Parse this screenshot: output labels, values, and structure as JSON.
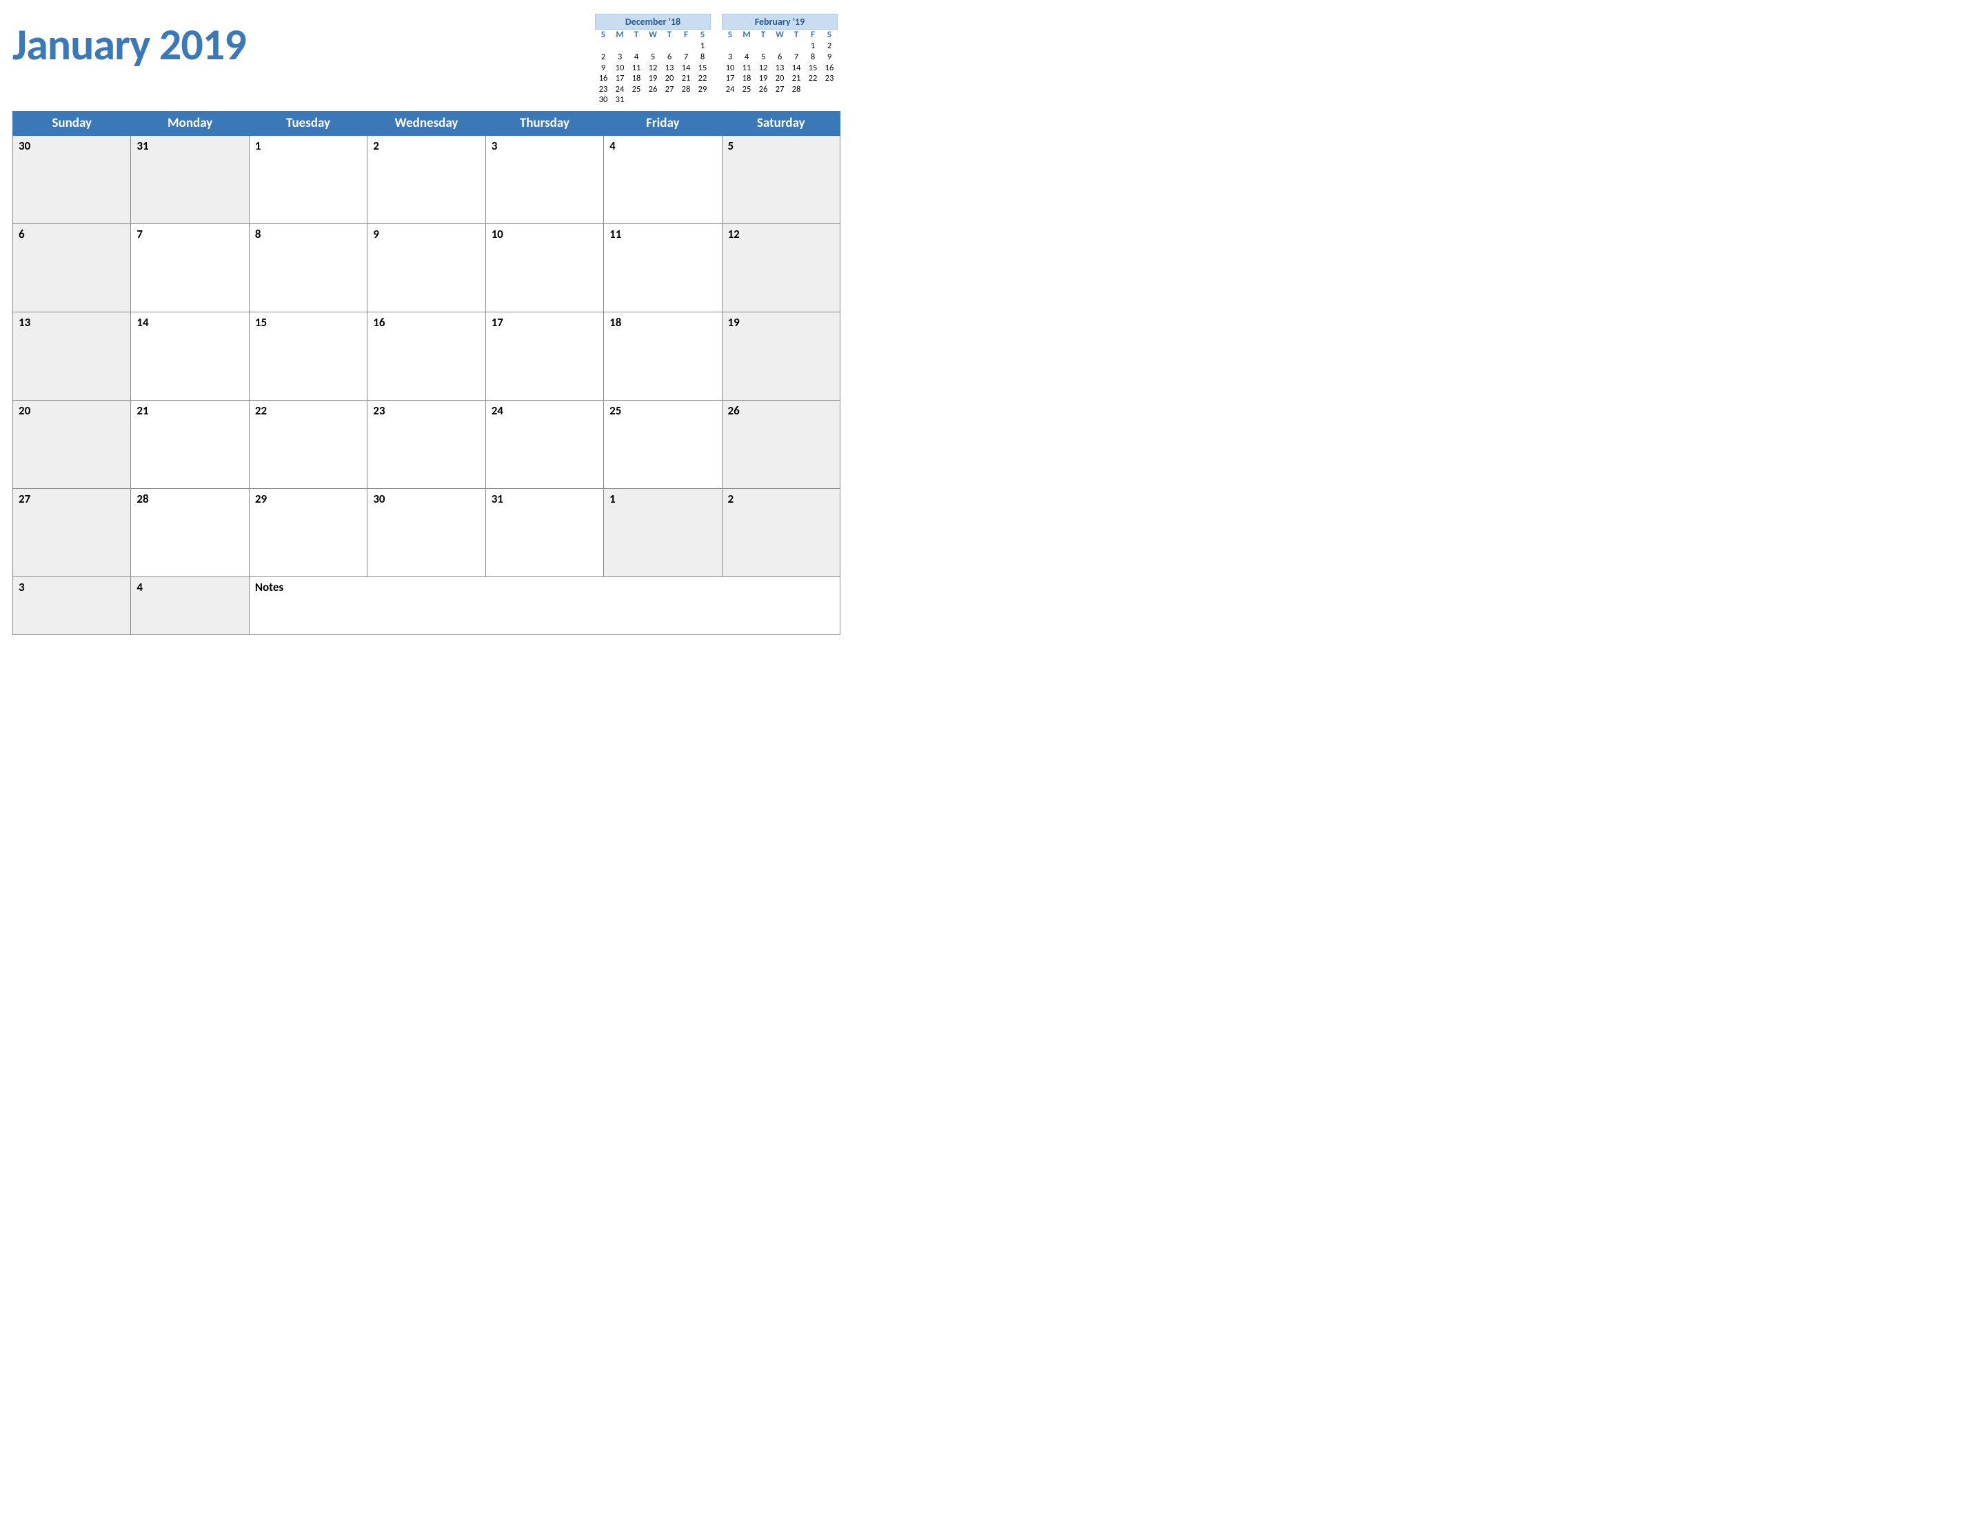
{
  "title": "January 2019",
  "dow_full": [
    "Sunday",
    "Monday",
    "Tuesday",
    "Wednesday",
    "Thursday",
    "Friday",
    "Saturday"
  ],
  "mini": [
    {
      "title": "December '18",
      "dow": [
        "S",
        "M",
        "T",
        "W",
        "T",
        "F",
        "S"
      ],
      "rows": [
        [
          "",
          "",
          "",
          "",
          "",
          "",
          "1"
        ],
        [
          "2",
          "3",
          "4",
          "5",
          "6",
          "7",
          "8"
        ],
        [
          "9",
          "10",
          "11",
          "12",
          "13",
          "14",
          "15"
        ],
        [
          "16",
          "17",
          "18",
          "19",
          "20",
          "21",
          "22"
        ],
        [
          "23",
          "24",
          "25",
          "26",
          "27",
          "28",
          "29"
        ],
        [
          "30",
          "31",
          "",
          "",
          "",
          "",
          ""
        ]
      ]
    },
    {
      "title": "February '19",
      "dow": [
        "S",
        "M",
        "T",
        "W",
        "T",
        "F",
        "S"
      ],
      "rows": [
        [
          "",
          "",
          "",
          "",
          "",
          "1",
          "2"
        ],
        [
          "3",
          "4",
          "5",
          "6",
          "7",
          "8",
          "9"
        ],
        [
          "10",
          "11",
          "12",
          "13",
          "14",
          "15",
          "16"
        ],
        [
          "17",
          "18",
          "19",
          "20",
          "21",
          "22",
          "23"
        ],
        [
          "24",
          "25",
          "26",
          "27",
          "28",
          "",
          ""
        ]
      ]
    }
  ],
  "grid": [
    [
      {
        "n": "30",
        "cls": "outside"
      },
      {
        "n": "31",
        "cls": "outside"
      },
      {
        "n": "1",
        "cls": ""
      },
      {
        "n": "2",
        "cls": ""
      },
      {
        "n": "3",
        "cls": ""
      },
      {
        "n": "4",
        "cls": ""
      },
      {
        "n": "5",
        "cls": "weekend"
      }
    ],
    [
      {
        "n": "6",
        "cls": "weekend"
      },
      {
        "n": "7",
        "cls": ""
      },
      {
        "n": "8",
        "cls": ""
      },
      {
        "n": "9",
        "cls": ""
      },
      {
        "n": "10",
        "cls": ""
      },
      {
        "n": "11",
        "cls": ""
      },
      {
        "n": "12",
        "cls": "weekend"
      }
    ],
    [
      {
        "n": "13",
        "cls": "weekend"
      },
      {
        "n": "14",
        "cls": ""
      },
      {
        "n": "15",
        "cls": ""
      },
      {
        "n": "16",
        "cls": ""
      },
      {
        "n": "17",
        "cls": ""
      },
      {
        "n": "18",
        "cls": ""
      },
      {
        "n": "19",
        "cls": "weekend"
      }
    ],
    [
      {
        "n": "20",
        "cls": "weekend"
      },
      {
        "n": "21",
        "cls": ""
      },
      {
        "n": "22",
        "cls": ""
      },
      {
        "n": "23",
        "cls": ""
      },
      {
        "n": "24",
        "cls": ""
      },
      {
        "n": "25",
        "cls": ""
      },
      {
        "n": "26",
        "cls": "weekend"
      }
    ],
    [
      {
        "n": "27",
        "cls": "weekend"
      },
      {
        "n": "28",
        "cls": ""
      },
      {
        "n": "29",
        "cls": ""
      },
      {
        "n": "30",
        "cls": ""
      },
      {
        "n": "31",
        "cls": ""
      },
      {
        "n": "1",
        "cls": "outside"
      },
      {
        "n": "2",
        "cls": "outside"
      }
    ]
  ],
  "lastrow": {
    "cells": [
      {
        "n": "3",
        "cls": "outside"
      },
      {
        "n": "4",
        "cls": "outside"
      }
    ],
    "notes_label": "Notes"
  }
}
